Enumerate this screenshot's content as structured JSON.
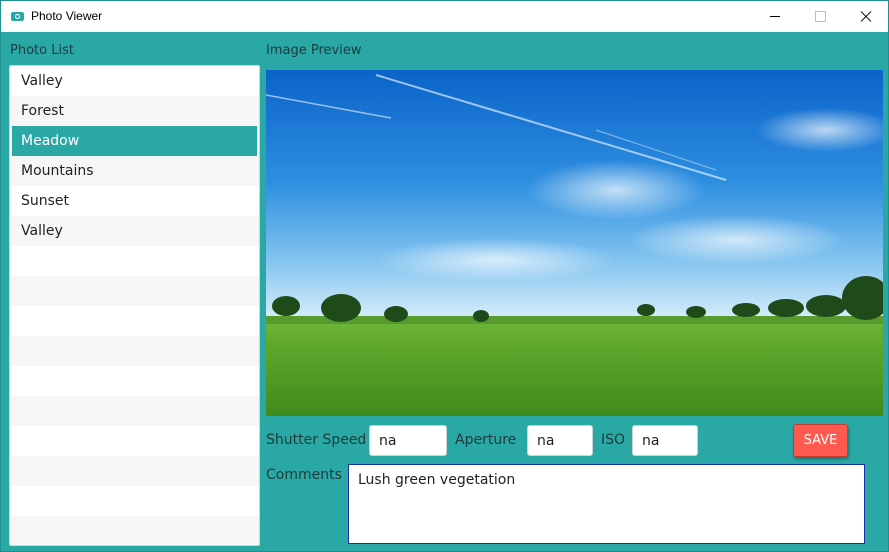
{
  "window": {
    "title": "Photo Viewer"
  },
  "sidebar": {
    "label": "Photo List",
    "items": [
      {
        "label": "Valley"
      },
      {
        "label": "Forest"
      },
      {
        "label": "Meadow",
        "selected": true
      },
      {
        "label": "Mountains"
      },
      {
        "label": "Sunset"
      },
      {
        "label": "Valley"
      }
    ]
  },
  "preview": {
    "label": "Image Preview"
  },
  "settings": {
    "shutter_label": "Shutter Speed",
    "shutter_value": "na",
    "aperture_label": "Aperture",
    "aperture_value": "na",
    "iso_label": "ISO",
    "iso_value": "na",
    "save_label": "SAVE"
  },
  "comments": {
    "label": "Comments",
    "value": "Lush green vegetation"
  },
  "colors": {
    "background": "#2aa8a6",
    "selection": "#2aa8a6",
    "save_button": "#ff5a4f",
    "comment_border": "#1a2fa8"
  }
}
